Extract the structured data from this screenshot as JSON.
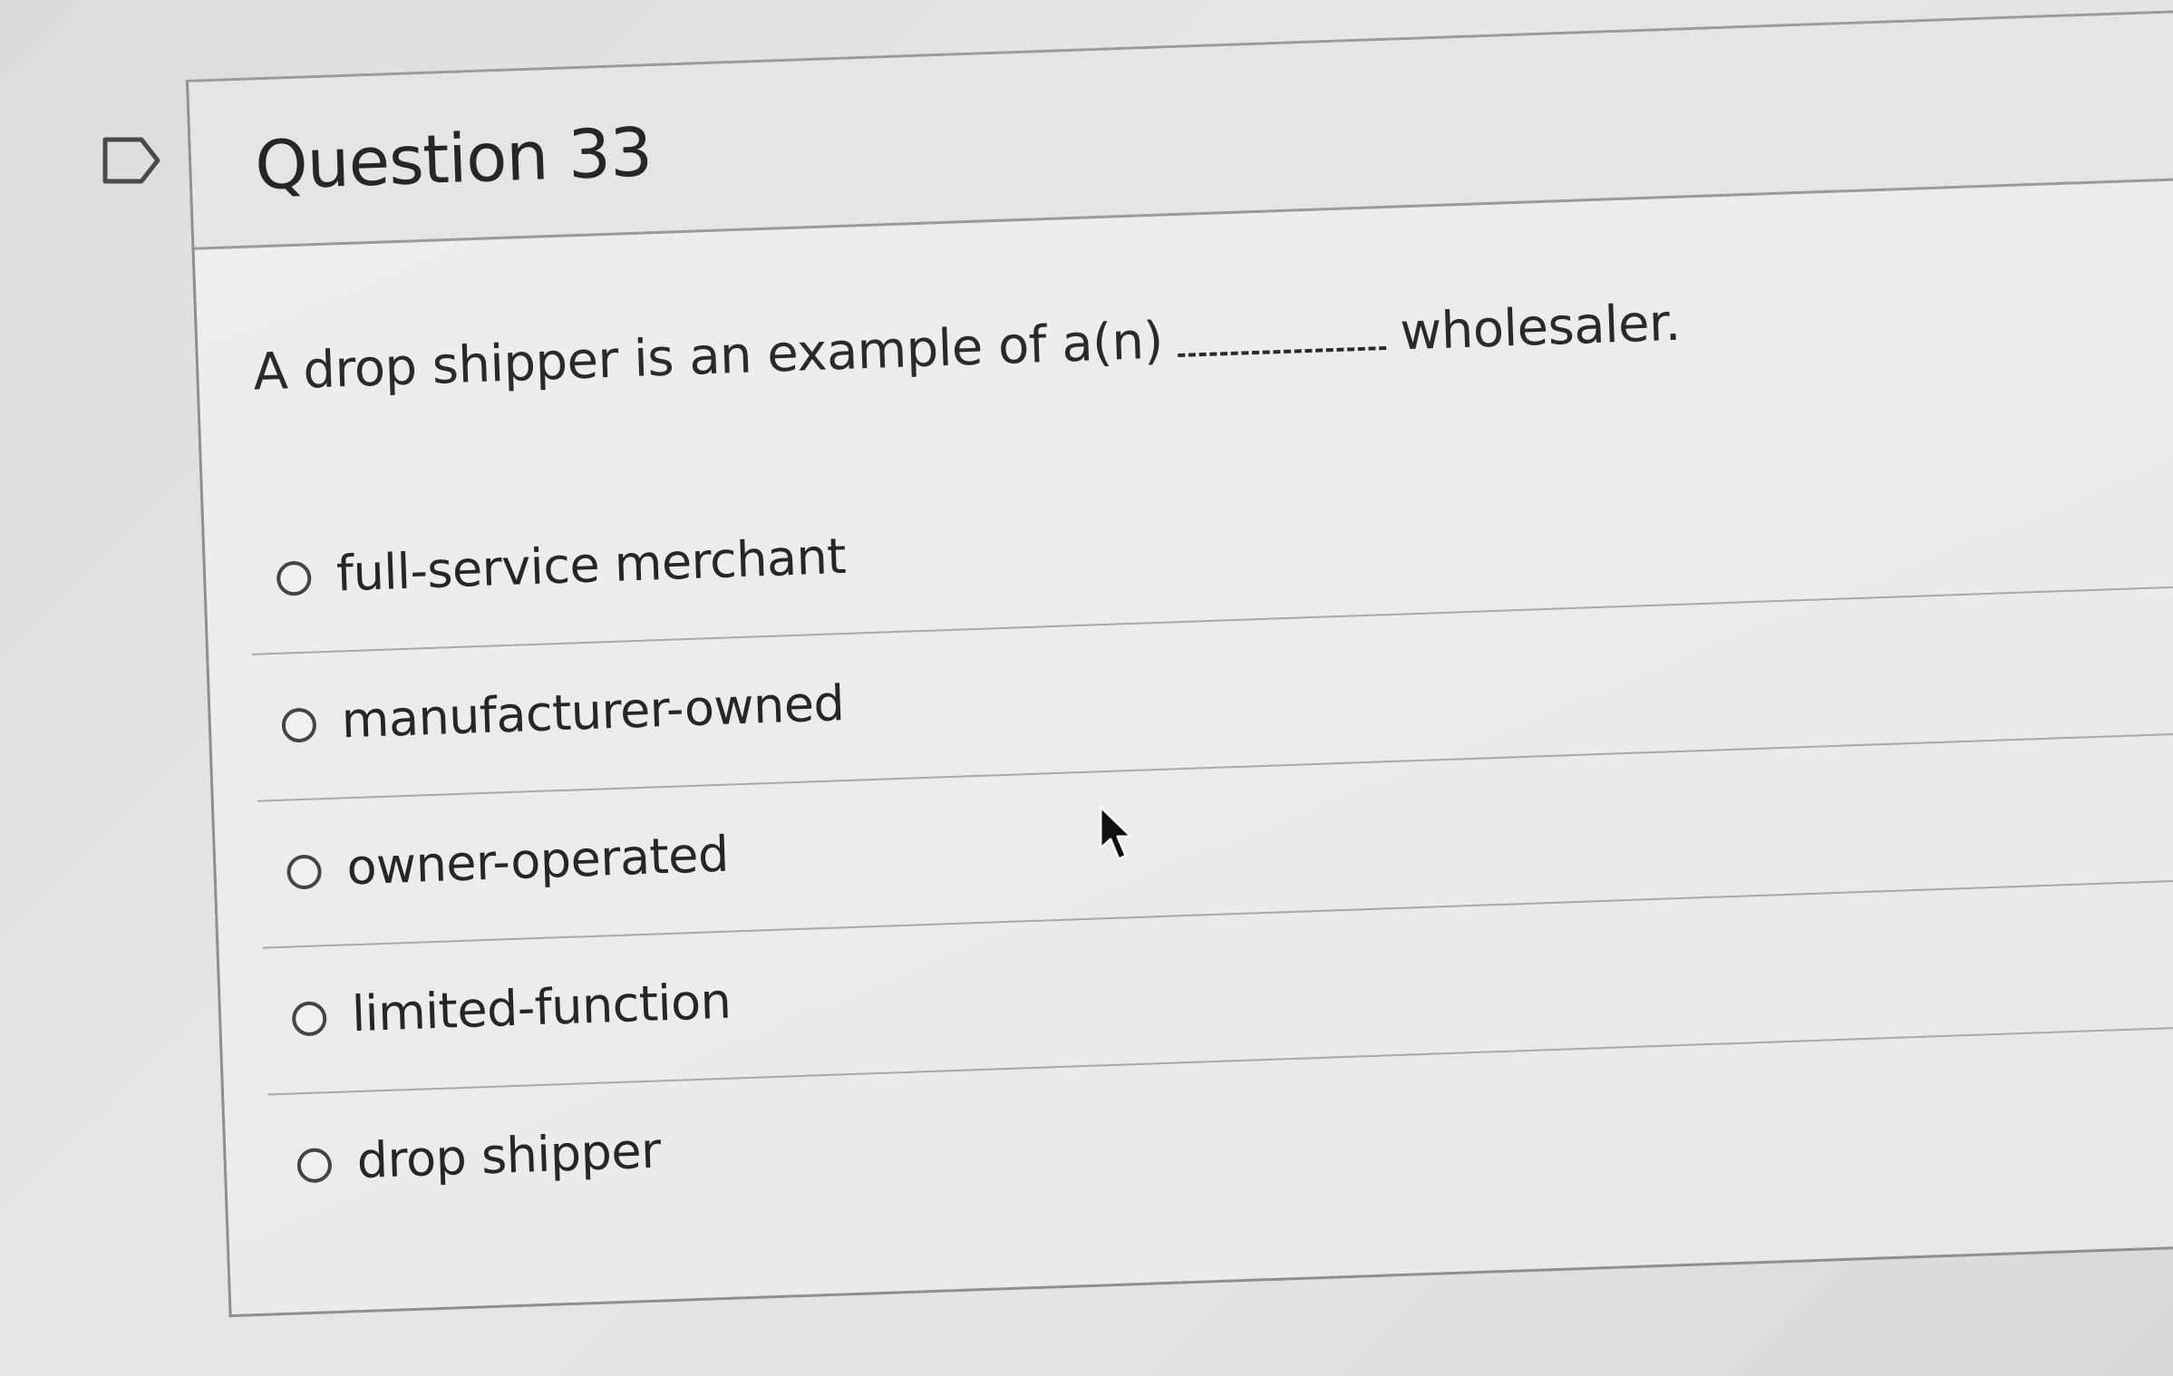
{
  "question": {
    "title": "Question 33",
    "text_before_blank": "A drop shipper is an example of a(n)",
    "text_after_blank": "wholesaler."
  },
  "answers": [
    {
      "label": "full-service merchant",
      "selected": false
    },
    {
      "label": "manufacturer-owned",
      "selected": false
    },
    {
      "label": "owner-operated",
      "selected": false
    },
    {
      "label": "limited-function",
      "selected": false
    },
    {
      "label": "drop shipper",
      "selected": false
    }
  ],
  "icons": {
    "flag": "flag-question-icon",
    "cursor": "mouse-pointer-icon"
  },
  "colors": {
    "text": "#2d2d2d",
    "border": "#9a9a9a",
    "background": "#e6e6e6"
  }
}
